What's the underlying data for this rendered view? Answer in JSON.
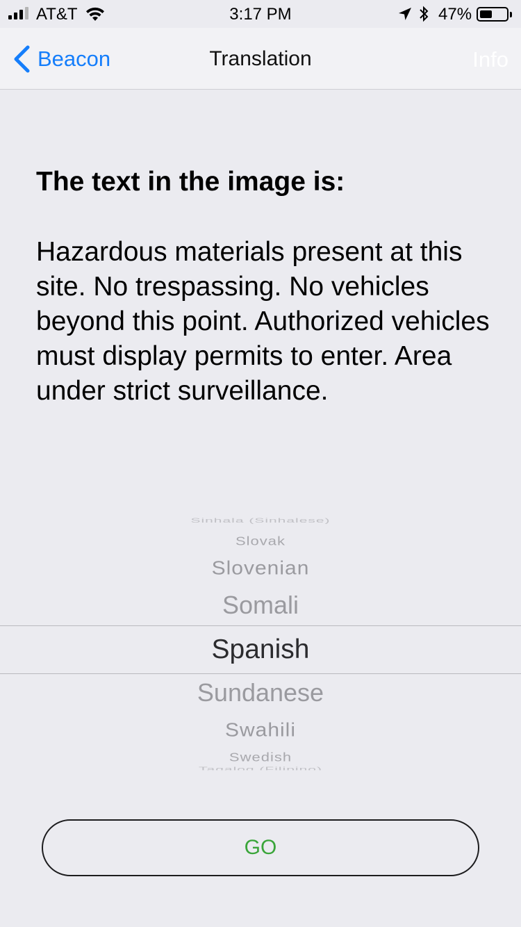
{
  "status_bar": {
    "carrier": "AT&T",
    "time": "3:17 PM",
    "battery_percent_label": "47%",
    "battery_level": 0.47,
    "signal_bars_active": 3,
    "signal_bars_total": 4,
    "icons": [
      "signal-icon",
      "wifi-icon",
      "location-arrow-icon",
      "bluetooth-icon",
      "battery-icon"
    ]
  },
  "nav": {
    "back_label": "Beacon",
    "title": "Translation",
    "info_label": "Info",
    "accent_color": "#157efb"
  },
  "content": {
    "heading": "The text in the image is:",
    "translated_text": "Hazardous materials present at this site. No trespassing. No vehicles beyond this point. Authorized vehicles must display permits to enter. Area under strict surveillance."
  },
  "language_picker": {
    "items": [
      "Sinhala (Sinhalese)",
      "Slovak",
      "Slovenian",
      "Somali",
      "Spanish",
      "Sundanese",
      "Swahili",
      "Swedish",
      "Tagalog (Filipino)"
    ],
    "selected": "Spanish"
  },
  "actions": {
    "go_label": "GO",
    "go_color": "#3aa53a"
  }
}
